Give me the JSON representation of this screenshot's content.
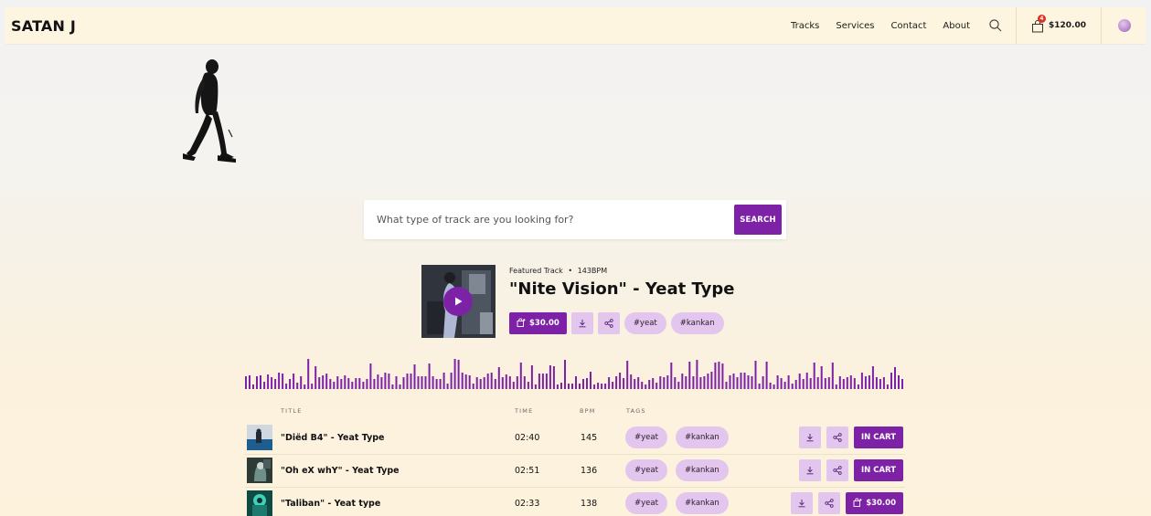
{
  "header": {
    "logo": "SATAN J",
    "nav": [
      "Tracks",
      "Services",
      "Contact",
      "About"
    ],
    "cart_count": "4",
    "cart_total": "$120.00"
  },
  "search": {
    "placeholder": "What type of track are you looking for?",
    "button": "SEARCH"
  },
  "featured": {
    "label": "Featured Track",
    "bpm": "143BPM",
    "separator": "•",
    "title": "\"Nite Vision\" - Yeat Type",
    "price": "$30.00",
    "tags": [
      "#yeat",
      "#kankan"
    ]
  },
  "table": {
    "headers": {
      "title": "TITLE",
      "time": "TIME",
      "bpm": "BPM",
      "tags": "TAGS"
    },
    "rows": [
      {
        "title": "\"Diëd B4\" - Yeat Type",
        "time": "02:40",
        "bpm": "145",
        "tags": [
          "#yeat",
          "#kankan"
        ],
        "action": "IN CART"
      },
      {
        "title": "\"Oh eX whY\" - Yeat Type",
        "time": "02:51",
        "bpm": "136",
        "tags": [
          "#yeat",
          "#kankan"
        ],
        "action": "IN CART"
      },
      {
        "title": "\"Taliban\" - Yeat type",
        "time": "02:33",
        "bpm": "138",
        "tags": [
          "#yeat",
          "#kankan"
        ],
        "action": "$30.00"
      }
    ]
  },
  "colors": {
    "accent": "#7d22a6",
    "tag_bg": "#e3c6ee",
    "header_bg": "#fdf5e0"
  },
  "icons": [
    "search-icon",
    "shopping-bag-icon",
    "avatar",
    "play-icon",
    "download-icon",
    "share-icon",
    "cart-add-icon"
  ]
}
